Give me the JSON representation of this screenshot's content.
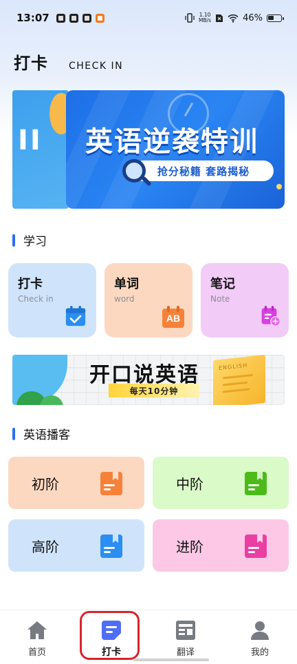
{
  "status_bar": {
    "time": "13:07",
    "network_speed_value": "1.10",
    "network_speed_unit": "MB/s",
    "battery": "46%"
  },
  "header": {
    "title": "打卡",
    "subtitle": "CHECK IN"
  },
  "banner": {
    "peek_text": "II",
    "title": "英语逆袭特训",
    "pill": "抢分秘籍 套路揭秘",
    "colors": {
      "primary": "#1d6fe6",
      "pill_text": "#1d5fd0"
    }
  },
  "study_section": {
    "title": "学习",
    "cards": [
      {
        "title": "打卡",
        "subtitle": "Check in",
        "icon": "calendar-check-icon",
        "bg": "#cfe4fb",
        "icon_color": "#2b8ef0"
      },
      {
        "title": "单词",
        "subtitle": "word",
        "icon": "calendar-ab-icon",
        "icon_text": "AB",
        "bg": "#fdd8c0",
        "icon_color": "#f6823a"
      },
      {
        "title": "笔记",
        "subtitle": "Note",
        "icon": "calendar-plus-icon",
        "bg": "#f2cbf7",
        "icon_color": "#d840e0"
      }
    ]
  },
  "speak_banner": {
    "title": "开口说英语",
    "subtitle": "每天10分钟",
    "book_label": "ENGLISH"
  },
  "podcast_section": {
    "title": "英语播客",
    "levels": [
      {
        "label": "初阶",
        "icon": "book-icon",
        "bg": "#fdd8c0",
        "icon_color": "#f6823a"
      },
      {
        "label": "中阶",
        "icon": "book-icon",
        "bg": "#dafbc8",
        "icon_color": "#4cbb1a"
      },
      {
        "label": "高阶",
        "icon": "book-icon",
        "bg": "#cfe4fb",
        "icon_color": "#2b8ef0"
      },
      {
        "label": "进阶",
        "icon": "book-icon",
        "bg": "#fcc8e6",
        "icon_color": "#ea3ea2"
      }
    ]
  },
  "bottom_nav": {
    "items": [
      {
        "label": "首页",
        "icon": "home-icon"
      },
      {
        "label": "打卡",
        "icon": "checkin-icon",
        "active": true
      },
      {
        "label": "翻译",
        "icon": "translate-icon"
      },
      {
        "label": "我的",
        "icon": "profile-icon"
      }
    ],
    "highlight_color": "#d8232a"
  }
}
